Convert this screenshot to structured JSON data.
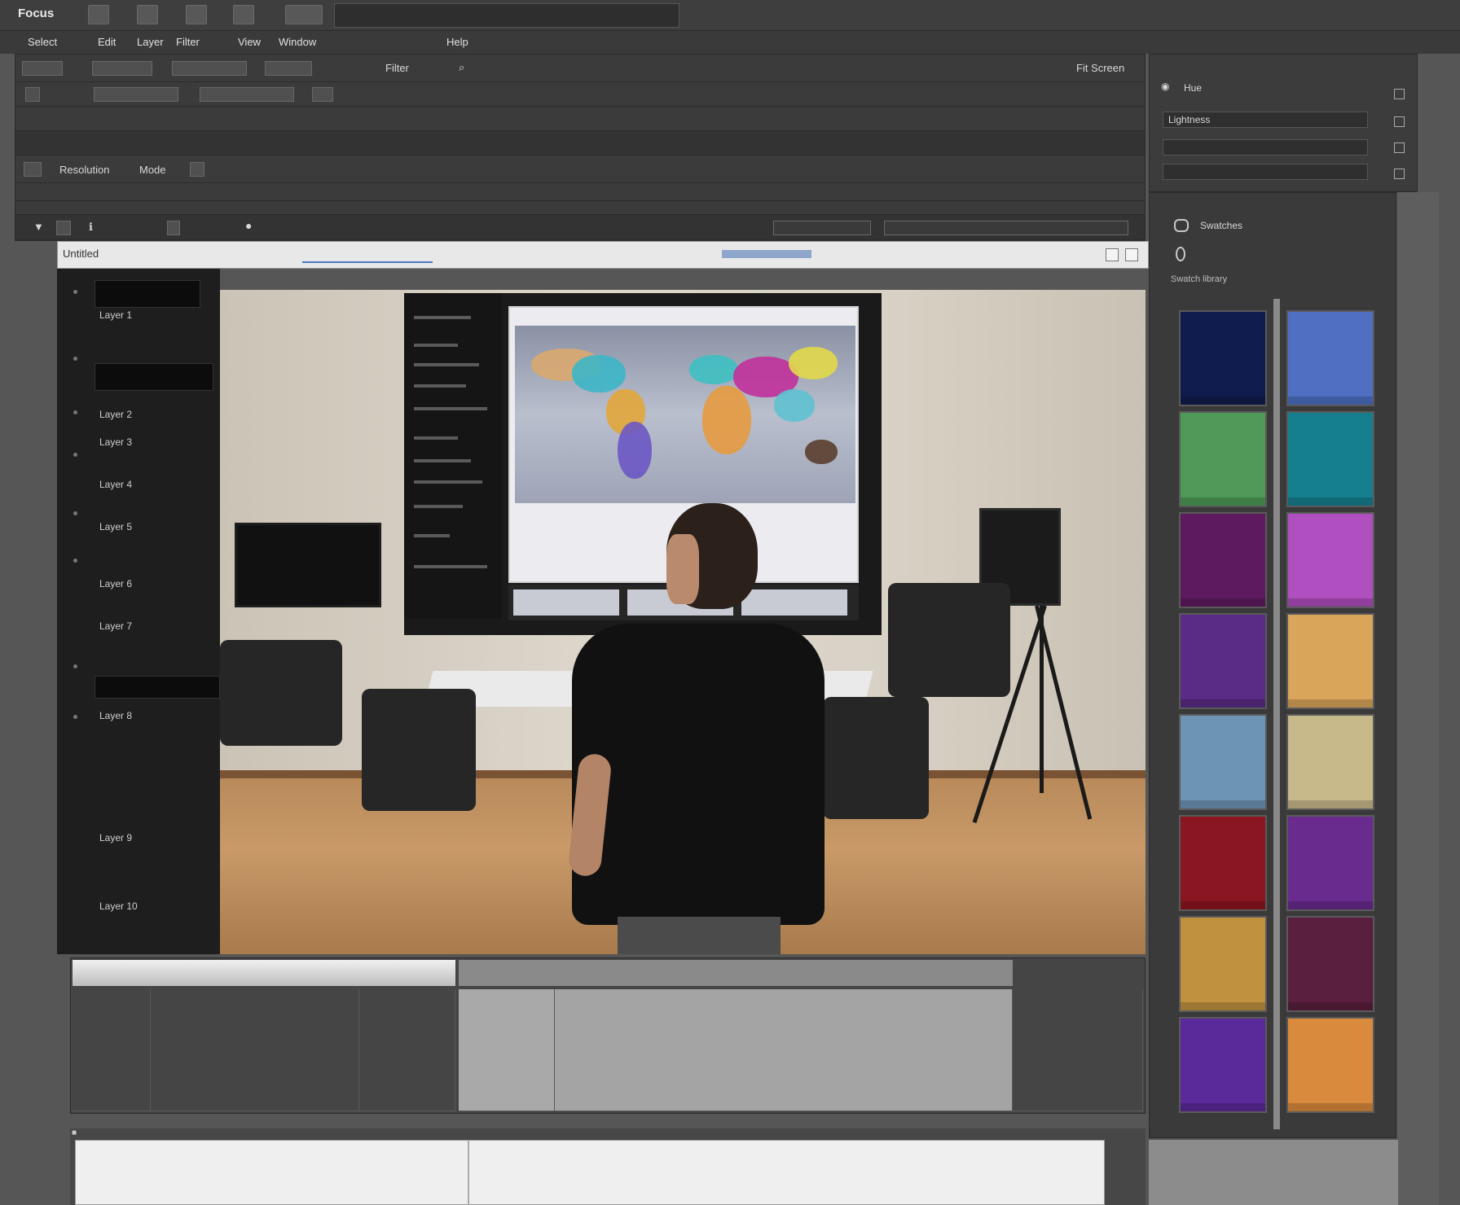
{
  "menubar": {
    "app_title": "Focus",
    "search_text": "",
    "right_label": ""
  },
  "submenu": {
    "items": [
      "Select",
      "Edit",
      "Layer",
      "Filter",
      "View",
      "Window",
      "Help"
    ]
  },
  "toolbar": {
    "center_label": "Filter",
    "right_label": "Fit Screen",
    "row3_text": "",
    "row5_label1": "Resolution",
    "row5_label2": "Mode"
  },
  "docbar": {
    "tab_label": "Untitled",
    "addr_text": ""
  },
  "layers_panel": {
    "items": [
      "Layer 1",
      "Layer 2",
      "Layer 3",
      "Layer 4",
      "Layer 5",
      "Layer 6",
      "Layer 7",
      "Layer 8",
      "Layer 9",
      "Layer 10"
    ]
  },
  "tools_panel": {
    "header": "",
    "row1": "Hue",
    "row2": "Lightness",
    "row3": "",
    "row4": ""
  },
  "swatch_panel": {
    "title": "Swatches",
    "header": "Swatch library",
    "colors": [
      "#101c4e",
      "#4e6fc2",
      "#4f9a58",
      "#167f8f",
      "#5e1a5e",
      "#b04fbf",
      "#5a2c86",
      "#d9a55a",
      "#6e94b5",
      "#c8b98a",
      "#8a1622",
      "#6a2b8e",
      "#c09240",
      "#5a1f3e",
      "#5b2a9a",
      "#d98a3c"
    ]
  },
  "timeline": {
    "labels": [
      "",
      "",
      ""
    ],
    "header_right": ""
  },
  "bottom": {
    "field_text": ""
  }
}
